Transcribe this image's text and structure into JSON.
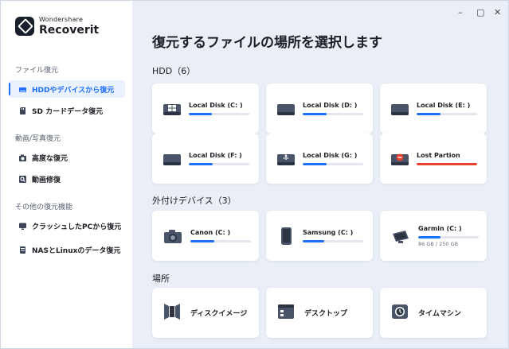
{
  "brand": {
    "small": "Wondershare",
    "name": "Recoverit"
  },
  "window_controls": {
    "minimize": "–",
    "maximize": "▢",
    "close": "✕"
  },
  "sidebar": {
    "sections": [
      {
        "title": "ファイル復元",
        "items": [
          {
            "label": "HDDやデバイスから復元",
            "icon": "hdd-icon",
            "active": true
          },
          {
            "label": "SD カードデータ復元",
            "icon": "sd-card-icon",
            "active": false
          }
        ]
      },
      {
        "title": "動画/写真復元",
        "items": [
          {
            "label": "高度な復元",
            "icon": "camera-icon",
            "active": false
          },
          {
            "label": "動画修復",
            "icon": "video-repair-icon",
            "active": false
          }
        ]
      },
      {
        "title": "その他の復元機能",
        "items": [
          {
            "label": "クラッシュしたPCから復元",
            "icon": "monitor-icon",
            "active": false
          },
          {
            "label": "NASとLinuxのデータ復元",
            "icon": "nas-icon",
            "active": false
          }
        ]
      }
    ]
  },
  "main": {
    "title": "復元するファイルの場所を選択します",
    "hdd_group": {
      "title": "HDD（6）"
    },
    "drives": [
      {
        "name": "Local Disk (C: )",
        "usage": 0.38,
        "icon": "windows-drive-icon",
        "color": "#1d6ff5"
      },
      {
        "name": "Local Disk (D: )",
        "usage": 0.4,
        "icon": "drive-icon",
        "color": "#1d6ff5"
      },
      {
        "name": "Local Disk (E: )",
        "usage": 0.4,
        "icon": "drive-icon",
        "color": "#1d6ff5"
      },
      {
        "name": "Local Disk (F: )",
        "usage": 0.4,
        "icon": "drive-icon",
        "color": "#1d6ff5"
      },
      {
        "name": "Local Disk (G: )",
        "usage": 0.4,
        "icon": "usb-drive-icon",
        "color": "#1d6ff5"
      },
      {
        "name": "Lost Partion",
        "usage": 1.0,
        "icon": "lost-partition-icon",
        "color": "#e8412d"
      }
    ],
    "external_group": {
      "title": "外付けデバイス（3）"
    },
    "external": [
      {
        "name": "Canon (C: )",
        "usage": 0.4,
        "icon": "camera-device-icon"
      },
      {
        "name": "Samsung (C: )",
        "usage": 0.36,
        "icon": "phone-icon"
      },
      {
        "name": "Garmin (C: )",
        "usage": 0.37,
        "icon": "gps-device-icon",
        "capacity": "86 GB / 250 GB"
      }
    ],
    "locations_group": {
      "title": "場所"
    },
    "locations": [
      {
        "name": "ディスクイメージ",
        "icon": "disk-image-icon"
      },
      {
        "name": "デスクトップ",
        "icon": "desktop-icon"
      },
      {
        "name": "タイムマシン",
        "icon": "time-machine-icon"
      }
    ]
  }
}
